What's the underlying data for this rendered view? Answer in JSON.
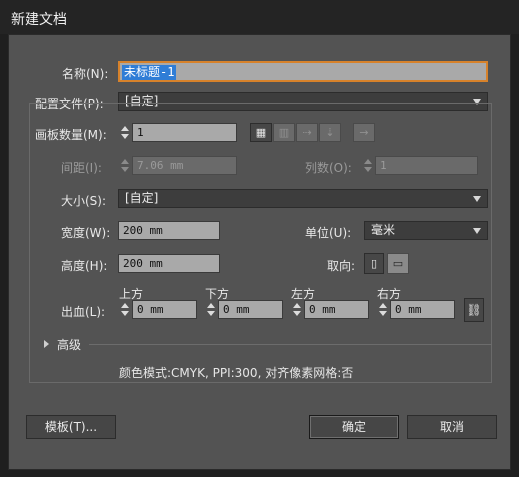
{
  "window": {
    "title": "新建文档"
  },
  "name": {
    "label": "名称(N):",
    "value": "未标题-1"
  },
  "profile": {
    "label": "配置文件(P):",
    "value": "[自定]"
  },
  "artboards": {
    "count_label": "画板数量(M):",
    "count_value": "1",
    "spacing_label": "间距(I):",
    "spacing_value": "7.06 mm",
    "columns_label": "列数(O):",
    "columns_value": "1",
    "arrange_icons": [
      "grid-by-row-icon",
      "grid-by-column-icon",
      "arrange-by-row-icon",
      "arrange-by-column-icon",
      "right-to-left-icon"
    ]
  },
  "size": {
    "label": "大小(S):",
    "value": "[自定]"
  },
  "width": {
    "label": "宽度(W):",
    "value": "200 mm"
  },
  "height": {
    "label": "高度(H):",
    "value": "200 mm"
  },
  "units": {
    "label": "单位(U):",
    "value": "毫米"
  },
  "orientation": {
    "label": "取向:",
    "icons": [
      "portrait-icon",
      "landscape-icon"
    ]
  },
  "bleed": {
    "label": "出血(L):",
    "top_label": "上方",
    "top_value": "0 mm",
    "bottom_label": "下方",
    "bottom_value": "0 mm",
    "left_label": "左方",
    "left_value": "0 mm",
    "right_label": "右方",
    "right_value": "0 mm"
  },
  "advanced": {
    "label": "高级"
  },
  "info": {
    "text": "颜色模式:CMYK, PPI:300, 对齐像素网格:否"
  },
  "buttons": {
    "templates": "模板(T)...",
    "ok": "确定",
    "cancel": "取消"
  }
}
